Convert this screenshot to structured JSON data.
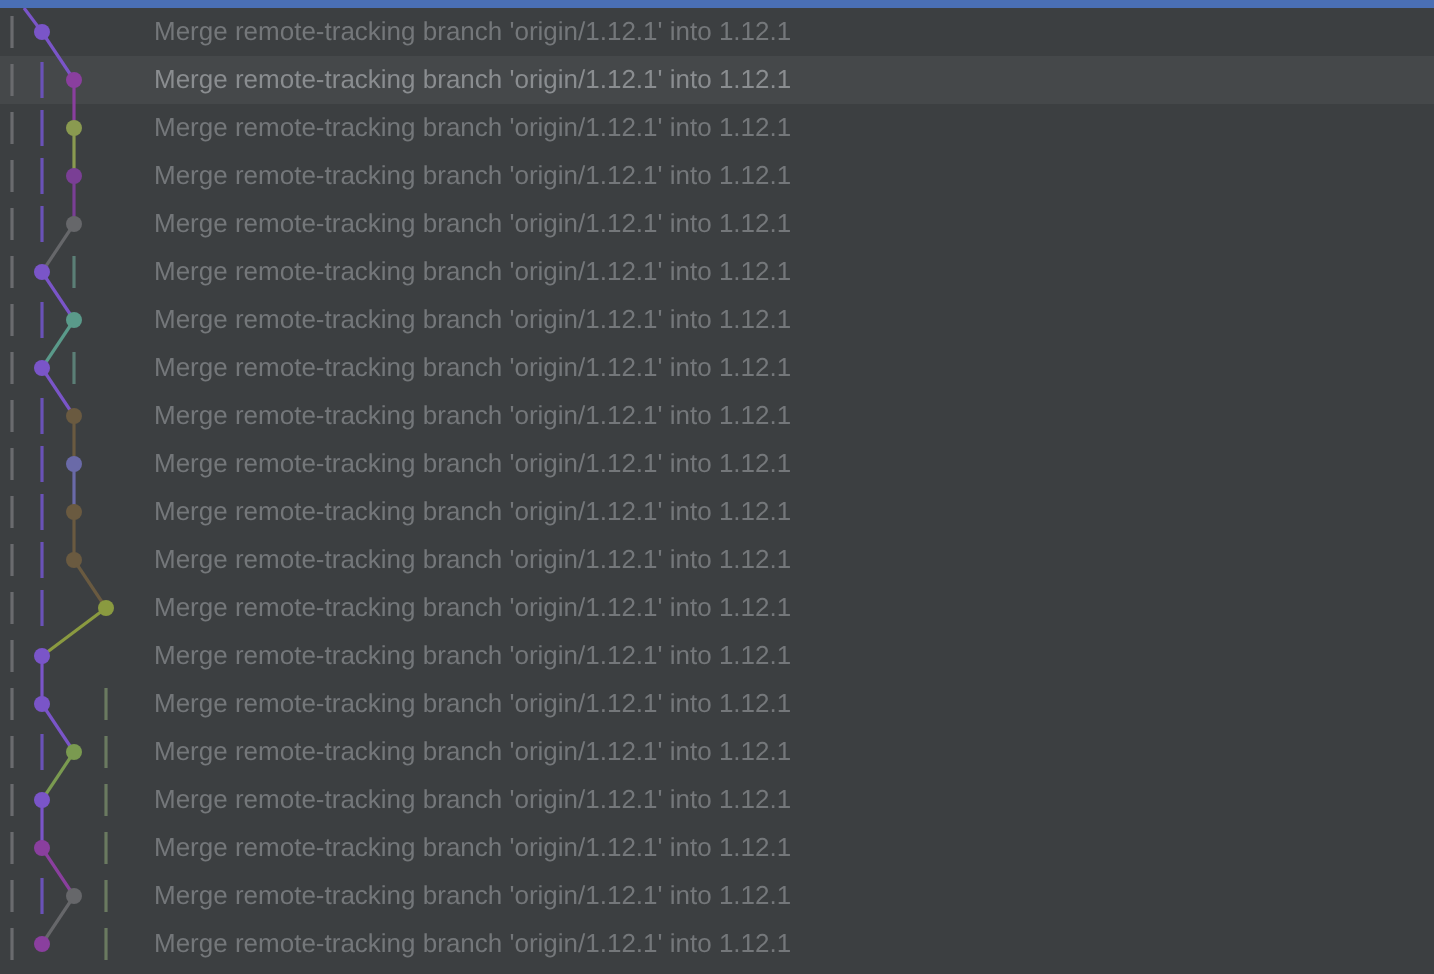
{
  "commits": [
    {
      "message": "Merge remote-tracking branch 'origin/1.12.1' into 1.12.1",
      "selected": false
    },
    {
      "message": "Merge remote-tracking branch 'origin/1.12.1' into 1.12.1",
      "selected": true
    },
    {
      "message": "Merge remote-tracking branch 'origin/1.12.1' into 1.12.1",
      "selected": false
    },
    {
      "message": "Merge remote-tracking branch 'origin/1.12.1' into 1.12.1",
      "selected": false
    },
    {
      "message": "Merge remote-tracking branch 'origin/1.12.1' into 1.12.1",
      "selected": false
    },
    {
      "message": "Merge remote-tracking branch 'origin/1.12.1' into 1.12.1",
      "selected": false
    },
    {
      "message": "Merge remote-tracking branch 'origin/1.12.1' into 1.12.1",
      "selected": false
    },
    {
      "message": "Merge remote-tracking branch 'origin/1.12.1' into 1.12.1",
      "selected": false
    },
    {
      "message": "Merge remote-tracking branch 'origin/1.12.1' into 1.12.1",
      "selected": false
    },
    {
      "message": "Merge remote-tracking branch 'origin/1.12.1' into 1.12.1",
      "selected": false
    },
    {
      "message": "Merge remote-tracking branch 'origin/1.12.1' into 1.12.1",
      "selected": false
    },
    {
      "message": "Merge remote-tracking branch 'origin/1.12.1' into 1.12.1",
      "selected": false
    },
    {
      "message": "Merge remote-tracking branch 'origin/1.12.1' into 1.12.1",
      "selected": false
    },
    {
      "message": "Merge remote-tracking branch 'origin/1.12.1' into 1.12.1",
      "selected": false
    },
    {
      "message": "Merge remote-tracking branch 'origin/1.12.1' into 1.12.1",
      "selected": false
    },
    {
      "message": "Merge remote-tracking branch 'origin/1.12.1' into 1.12.1",
      "selected": false
    },
    {
      "message": "Merge remote-tracking branch 'origin/1.12.1' into 1.12.1",
      "selected": false
    },
    {
      "message": "Merge remote-tracking branch 'origin/1.12.1' into 1.12.1",
      "selected": false
    },
    {
      "message": "Merge remote-tracking branch 'origin/1.12.1' into 1.12.1",
      "selected": false
    },
    {
      "message": "Merge remote-tracking branch 'origin/1.12.1' into 1.12.1",
      "selected": false
    }
  ]
}
